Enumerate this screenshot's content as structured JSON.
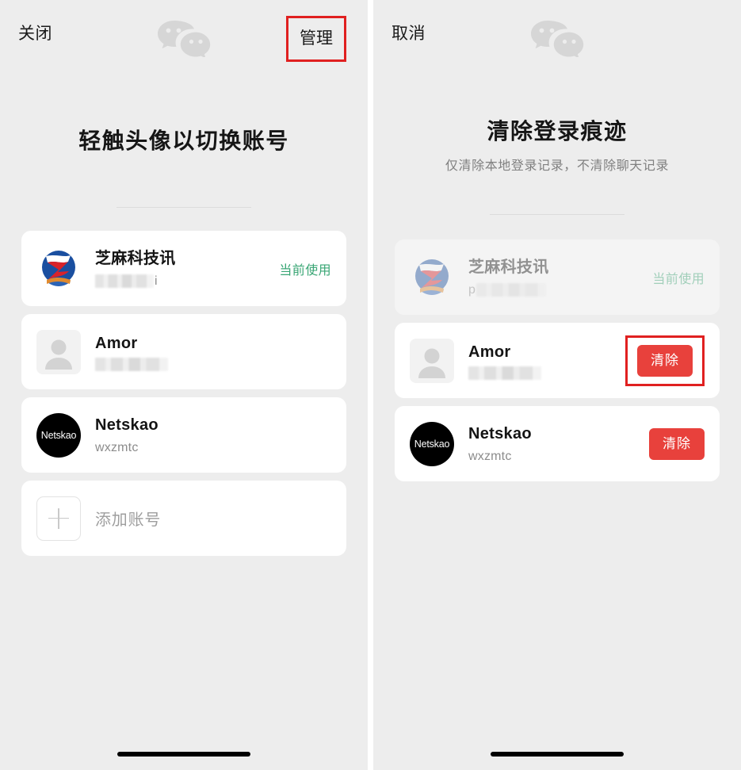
{
  "left_panel": {
    "topbar": {
      "close_label": "关闭",
      "manage_label": "管理",
      "logo_icon": "wechat-logo-icon"
    },
    "title": "轻触头像以切换账号",
    "accounts": [
      {
        "name": "芝麻科技讯",
        "username_redacted": true,
        "username_suffix": "i",
        "status": "当前使用",
        "avatar_type": "brand-logo"
      },
      {
        "name": "Amor",
        "username_redacted": true,
        "username_suffix": "",
        "status": "",
        "avatar_type": "default-person"
      },
      {
        "name": "Netskao",
        "username": "wxzmtc",
        "status": "",
        "avatar_type": "initials-dark",
        "avatar_initials": "Netskao"
      }
    ],
    "add_account_label": "添加账号",
    "add_icon": "plus-icon"
  },
  "right_panel": {
    "topbar": {
      "cancel_label": "取消",
      "logo_icon": "wechat-logo-icon"
    },
    "title": "清除登录痕迹",
    "subtitle": "仅清除本地登录记录，不清除聊天记录",
    "accounts": [
      {
        "name": "芝麻科技讯",
        "username_prefix": "p",
        "username_redacted": true,
        "status": "当前使用",
        "avatar_type": "brand-logo",
        "disabled": true,
        "action_label": ""
      },
      {
        "name": "Amor",
        "username_redacted": true,
        "status": "",
        "avatar_type": "default-person",
        "disabled": false,
        "action_label": "清除",
        "highlighted": true
      },
      {
        "name": "Netskao",
        "username": "wxzmtc",
        "status": "",
        "avatar_type": "initials-dark",
        "avatar_initials": "Netskao",
        "disabled": false,
        "action_label": "清除",
        "highlighted": false
      }
    ]
  },
  "colors": {
    "background": "#ededed",
    "card": "#ffffff",
    "accent_green": "#3aa675",
    "danger_red": "#e8413c",
    "annotation_red": "#e02020",
    "text_primary": "#141414",
    "text_secondary": "#8c8c8c"
  }
}
